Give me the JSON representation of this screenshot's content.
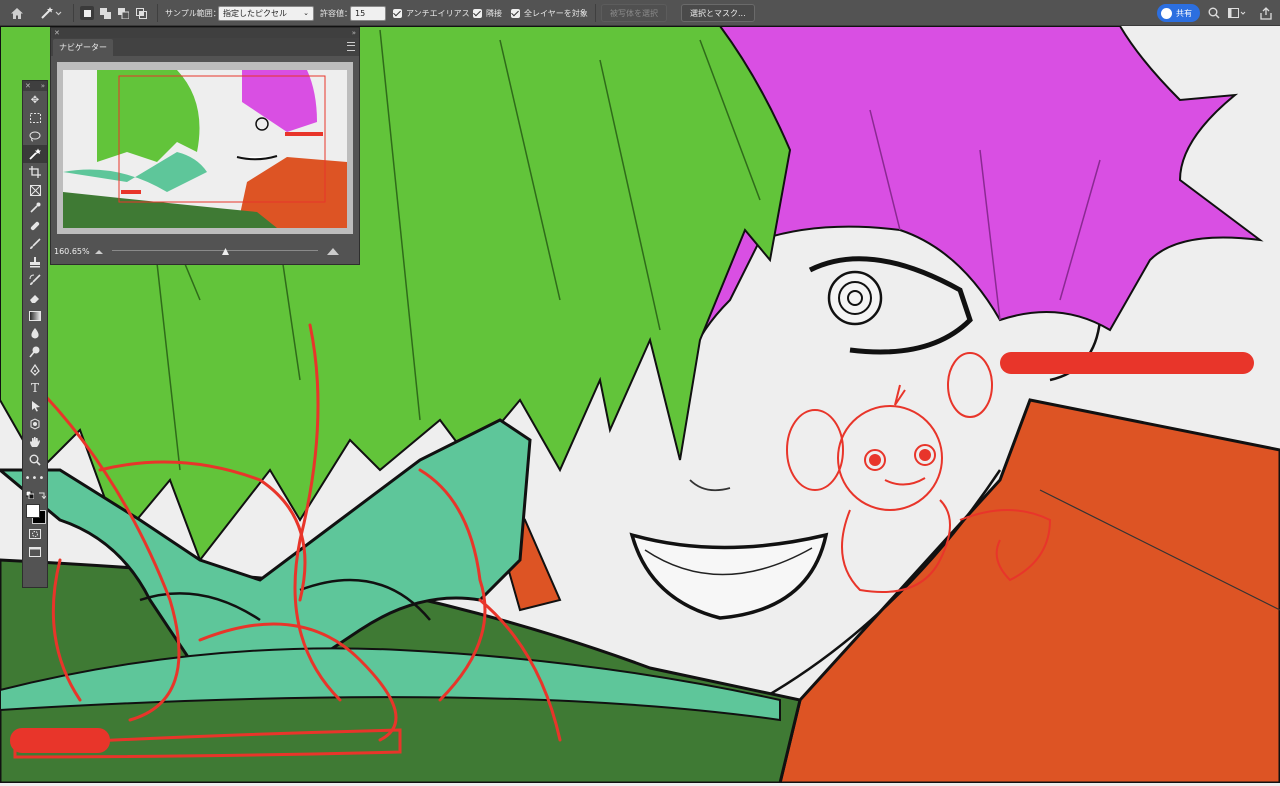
{
  "options_bar": {
    "sample_label": "サンプル範囲：",
    "sample_value": "指定したピクセル",
    "tolerance_label": "許容値：",
    "tolerance_value": "15",
    "antialias_label": "アンチエイリアス",
    "contiguous_label": "隣接",
    "all_layers_label": "全レイヤーを対象",
    "select_subject_label": "被写体を選択",
    "select_mask_label": "選択とマスク...",
    "share_label": "共有"
  },
  "navigator": {
    "tab_label": "ナビゲーター",
    "zoom": "160.65%",
    "zoom_fraction": 0.55
  },
  "colors": {
    "panel": "#535353",
    "panel_dark": "#3f3f3f",
    "accent_blue": "#2c6fe0",
    "hair_green": "#62c43a",
    "hair_magenta": "#d94fe3",
    "bow_teal": "#5ec69a",
    "coat_orange": "#dd5424",
    "shirt_green": "#3f7a34",
    "sketch_red": "#e8352a"
  },
  "icons": [
    "home-icon",
    "magic-wand-icon",
    "move-icon",
    "marquee-icon",
    "lasso-icon",
    "crop-icon",
    "frame-icon",
    "eyedropper-icon",
    "healing-icon",
    "brush-icon",
    "stamp-icon",
    "history-brush-icon",
    "eraser-icon",
    "gradient-icon",
    "blur-icon",
    "dodge-icon",
    "pen-icon",
    "type-icon",
    "path-select-icon",
    "shape-icon",
    "hand-icon",
    "zoom-icon",
    "more-icon",
    "swap-colors-icon",
    "default-colors-icon",
    "quick-mask-icon",
    "screen-mode-icon",
    "search-icon",
    "workspace-icon",
    "export-icon"
  ]
}
